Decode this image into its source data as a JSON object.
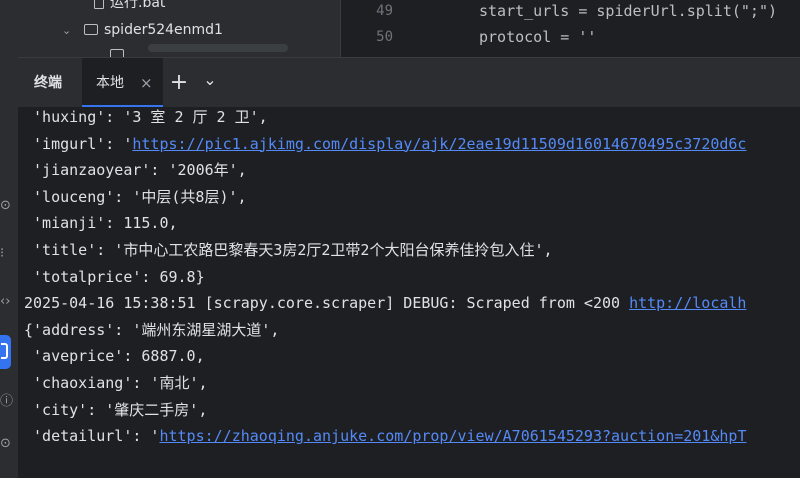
{
  "project_tree": {
    "items": [
      {
        "label": "运行.bat",
        "kind": "file"
      },
      {
        "label": "spider524enmd1",
        "kind": "folder"
      },
      {
        "label": "..",
        "kind": "folder"
      }
    ]
  },
  "editor": {
    "lines": [
      {
        "number": "49",
        "code": "start_urls = spiderUrl.split(\";\")"
      },
      {
        "number": "50",
        "code": "protocol = ''"
      }
    ]
  },
  "terminal": {
    "title": "终端",
    "tab_label": "本地",
    "close_glyph": "×",
    "add_glyph": "+",
    "dropdown_glyph": "⌄",
    "lines": [
      {
        "parts": [
          {
            "t": " 'huxing': '3 室 2 厅 2 卫',"
          }
        ]
      },
      {
        "parts": [
          {
            "t": " 'imgurl': '"
          },
          {
            "t": "https://pic1.ajkimg.com/display/ajk/2eae19d11509d16014670495c3720d6c",
            "link": true
          }
        ]
      },
      {
        "parts": [
          {
            "t": " 'jianzaoyear': '2006年',"
          }
        ]
      },
      {
        "parts": [
          {
            "t": " 'louceng': '中层(共8层)',"
          }
        ]
      },
      {
        "parts": [
          {
            "t": " 'mianji': 115.0,"
          }
        ]
      },
      {
        "parts": [
          {
            "t": " 'title': '市中心工农路巴黎春天3房2厅2卫带2个大阳台保养佳拎包入住',"
          }
        ]
      },
      {
        "parts": [
          {
            "t": " 'totalprice': 69.8}"
          }
        ]
      },
      {
        "parts": [
          {
            "t": "2025-04-16 15:38:51 [scrapy.core.scraper] DEBUG: Scraped from <200 "
          },
          {
            "t": "http://localh",
            "link": true
          }
        ]
      },
      {
        "parts": [
          {
            "t": "{'address': '端州东湖星湖大道',"
          }
        ]
      },
      {
        "parts": [
          {
            "t": " 'aveprice': 6887.0,"
          }
        ]
      },
      {
        "parts": [
          {
            "t": " 'chaoxiang': '南北',"
          }
        ]
      },
      {
        "parts": [
          {
            "t": " 'city': '肇庆二手房',"
          }
        ]
      },
      {
        "parts": [
          {
            "t": " 'detailurl': '"
          },
          {
            "t": "https://zhaoqing.anjuke.com/prop/view/A7061545293?auction=201&hpT",
            "link": true
          }
        ]
      }
    ]
  },
  "left_toolbar": {
    "icons": [
      "plugin-icon",
      "structure-icon",
      "code-icon",
      "terminal-icon",
      "problems-icon",
      "services-icon"
    ]
  },
  "colors": {
    "background": "#1e1f22",
    "panel": "#2b2d30",
    "accent": "#3574f0",
    "link": "#548af7",
    "string": "#6aab73"
  }
}
